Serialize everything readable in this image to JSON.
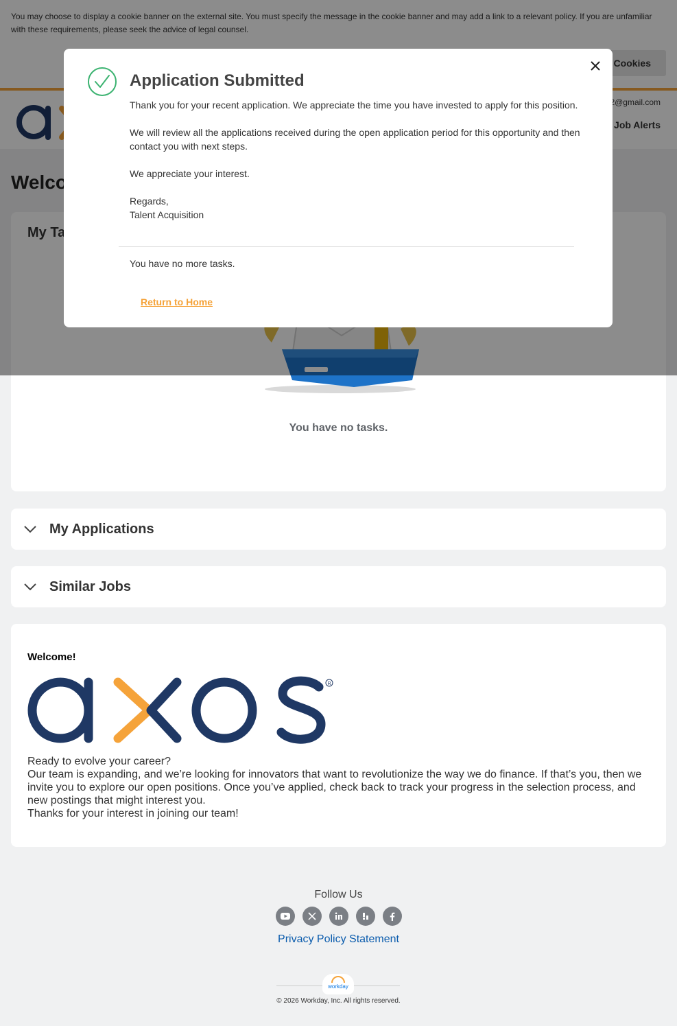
{
  "cookie": {
    "message": "You may choose to display a cookie banner on the external site. You must specify the message in the cookie banner and may add a link to a relevant policy. If you are unfamiliar with these requirements, please seek the advice of legal counsel.",
    "accept_label": "Accept Cookies"
  },
  "header": {
    "email": "2@gmail.com",
    "job_alerts": "Job Alerts"
  },
  "page": {
    "welcome_title": "Welcome"
  },
  "tasks": {
    "title": "My Tasks",
    "empty_text": "You have no tasks."
  },
  "accordions": {
    "applications": "My Applications",
    "similar_jobs": "Similar Jobs"
  },
  "info": {
    "welcome": "Welcome!",
    "logo_text": "axos",
    "line1": "Ready to evolve your career?",
    "line2": "Our team is expanding, and we’re looking for innovators that want to revolutionize the way we do finance. If that’s you, then we invite you to explore our open positions. Once you’ve applied, check back to track your progress in the selection process, and new postings that might interest you.",
    "line3": "Thanks for your interest in joining our team!"
  },
  "footer": {
    "follow": "Follow Us",
    "socials": [
      "youtube-icon",
      "x-icon",
      "linkedin-icon",
      "glassdoor-icon",
      "facebook-icon"
    ],
    "privacy": "Privacy Policy Statement",
    "workday": "workday",
    "copyright": "© 2026 Workday, Inc. All rights reserved."
  },
  "modal": {
    "title": "Application Submitted",
    "p1": "Thank you for your recent application. We appreciate the time you have invested to apply for this position.",
    "p2": "We will review all the applications received during the open application period for this opportunity and then contact you with next steps.",
    "p3": "We appreciate your interest.",
    "regards": "Regards,",
    "signature": "Talent Acquisition",
    "no_more_tasks": "You have no more tasks.",
    "return_home": "Return to Home"
  },
  "colors": {
    "brand_navy": "#1f3864",
    "brand_orange": "#f5a33a",
    "success_green": "#3cb371",
    "link_blue": "#0b5cad"
  }
}
